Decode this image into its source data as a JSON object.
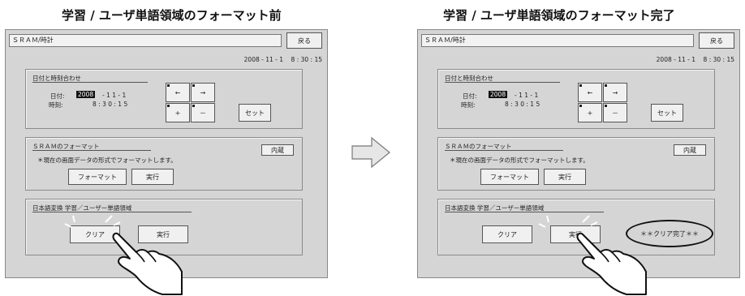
{
  "captions": {
    "left": "学習 / ユーザ単語領域のフォーマット前",
    "right": "学習 / ユーザ単語領域のフォーマット完了"
  },
  "screen": {
    "title": "ＳＲＡＭ/時計",
    "back_label": "戻る",
    "datetime": "2008 - 11 - 1    8 : 30 : 15",
    "date_panel": {
      "title": "日付と時刻合わせ",
      "date_label": "日付:",
      "time_label": "時刻:",
      "year": "2008",
      "date_rest": "-  1 1  -  1",
      "time_value": "8  :  3 0  :  1 5",
      "left_arrow": "←",
      "right_arrow": "→",
      "plus": "+",
      "minus": "－",
      "set_label": "セット"
    },
    "sram_panel": {
      "title": "ＳＲＡＭのフォーマット",
      "note": "＊現在の画面データの形式でフォーマットします。",
      "format_label": "フォーマット",
      "exec_label": "実行",
      "builtin_label": "内蔵"
    },
    "dict_panel": {
      "title": "日本語変換  学習／ユーザー単語領域",
      "clear_label": "クリア",
      "exec_label": "実行"
    },
    "status_done": "＊＊クリア完了＊＊"
  },
  "icons": {
    "arrow": "right-arrow-icon",
    "hand": "pointing-hand-icon"
  },
  "colors": {
    "screen_bg": "#d5d5d5",
    "button_bg": "#f0f0f0"
  }
}
